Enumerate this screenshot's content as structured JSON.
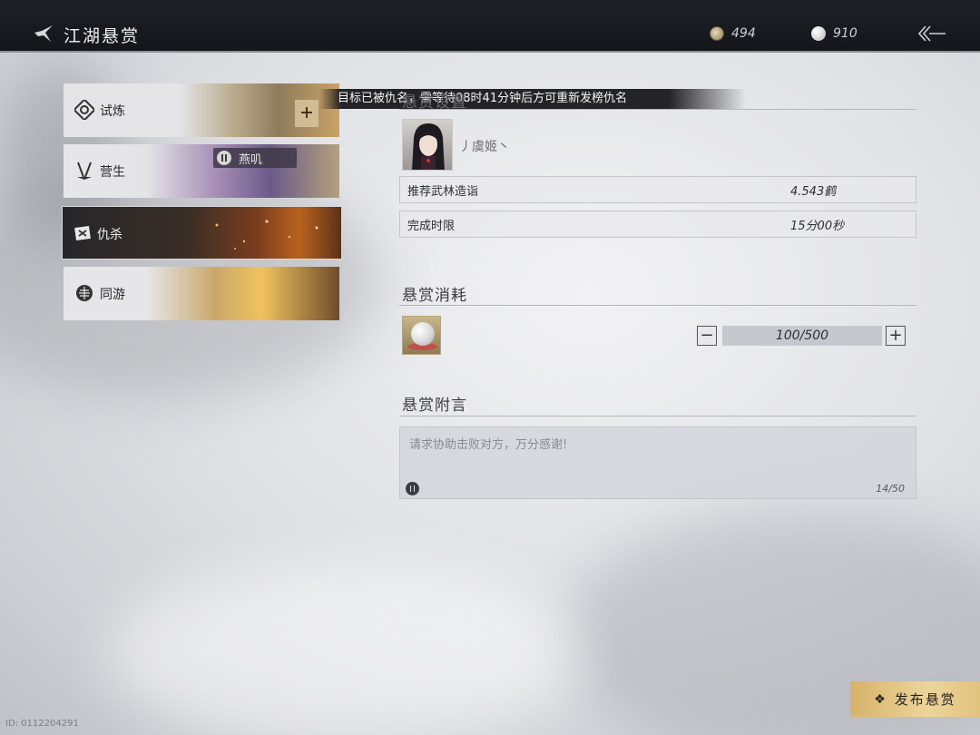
{
  "header": {
    "title": "江湖悬赏",
    "currency": [
      {
        "icon": "copper-coin-icon",
        "value": "494"
      },
      {
        "icon": "pearl-icon",
        "value": "910"
      }
    ]
  },
  "categories": [
    {
      "label": "试炼",
      "icon": "trial-icon"
    },
    {
      "label": "营生",
      "icon": "livelihood-icon"
    },
    {
      "label": "仇杀",
      "icon": "vendetta-icon",
      "selected": true
    },
    {
      "label": "同游",
      "icon": "companion-icon"
    }
  ],
  "friend_tag": "燕叽",
  "toast": "目标已被仇名，需等待08时41分钟后方可重新发榜仇名",
  "settings": {
    "title": "悬赏设置",
    "target_name": "丿虞姬丶",
    "rows": [
      {
        "key": "推荐武林造诣",
        "value": "4.543鹤"
      },
      {
        "key": "完成时限",
        "value": "15分00秒"
      }
    ]
  },
  "cost": {
    "title": "悬赏消耗",
    "quantity": "100/500"
  },
  "note": {
    "title": "悬赏附言",
    "text": "请求协助击败对方，万分感谢!",
    "counter": "14/50"
  },
  "publish_label": "发布悬赏",
  "player_id": "ID: 0112204291",
  "colors": {
    "accent_gold": "#e4c581",
    "topbar": "#1a1c21"
  }
}
